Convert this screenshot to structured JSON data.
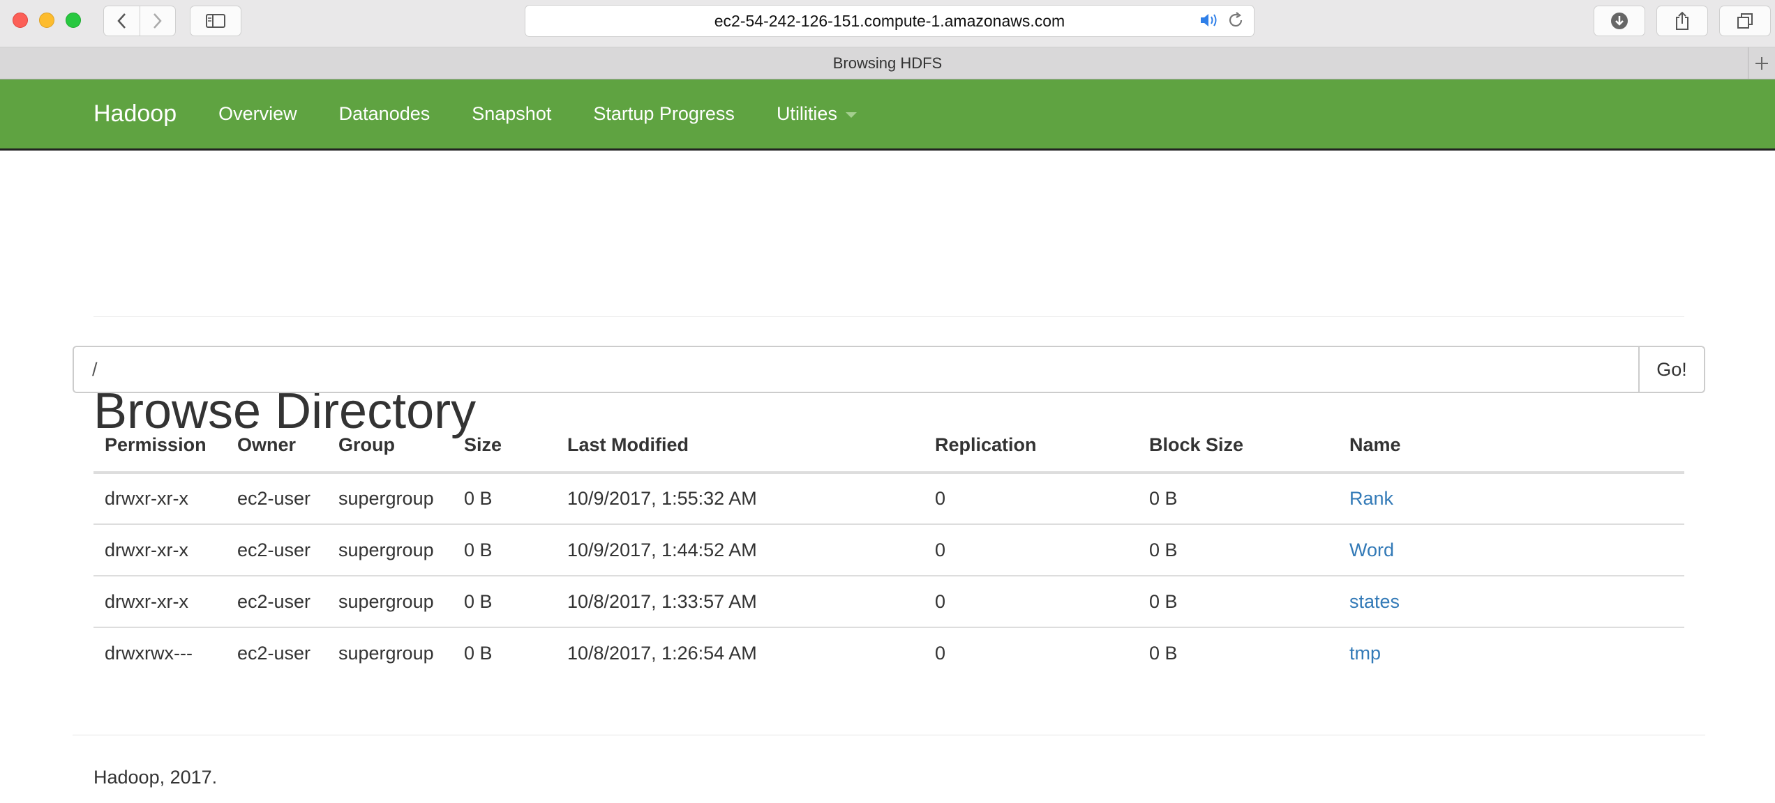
{
  "browser": {
    "url": "ec2-54-242-126-151.compute-1.amazonaws.com",
    "tab_title": "Browsing HDFS"
  },
  "navbar": {
    "brand": "Hadoop",
    "links": [
      "Overview",
      "Datanodes",
      "Snapshot",
      "Startup Progress",
      "Utilities"
    ],
    "color": "#5fa341"
  },
  "page": {
    "title": "Browse Directory",
    "path_value": "/",
    "go_label": "Go!"
  },
  "table": {
    "headers": [
      "Permission",
      "Owner",
      "Group",
      "Size",
      "Last Modified",
      "Replication",
      "Block Size",
      "Name"
    ],
    "rows": [
      [
        "drwxr-xr-x",
        "ec2-user",
        "supergroup",
        "0 B",
        "10/9/2017, 1:55:32 AM",
        "0",
        "0 B",
        "Rank"
      ],
      [
        "drwxr-xr-x",
        "ec2-user",
        "supergroup",
        "0 B",
        "10/9/2017, 1:44:52 AM",
        "0",
        "0 B",
        "Word"
      ],
      [
        "drwxr-xr-x",
        "ec2-user",
        "supergroup",
        "0 B",
        "10/8/2017, 1:33:57 AM",
        "0",
        "0 B",
        "states"
      ],
      [
        "drwxrwx---",
        "ec2-user",
        "supergroup",
        "0 B",
        "10/8/2017, 1:26:54 AM",
        "0",
        "0 B",
        "tmp"
      ]
    ]
  },
  "footer": {
    "text": "Hadoop, 2017."
  }
}
